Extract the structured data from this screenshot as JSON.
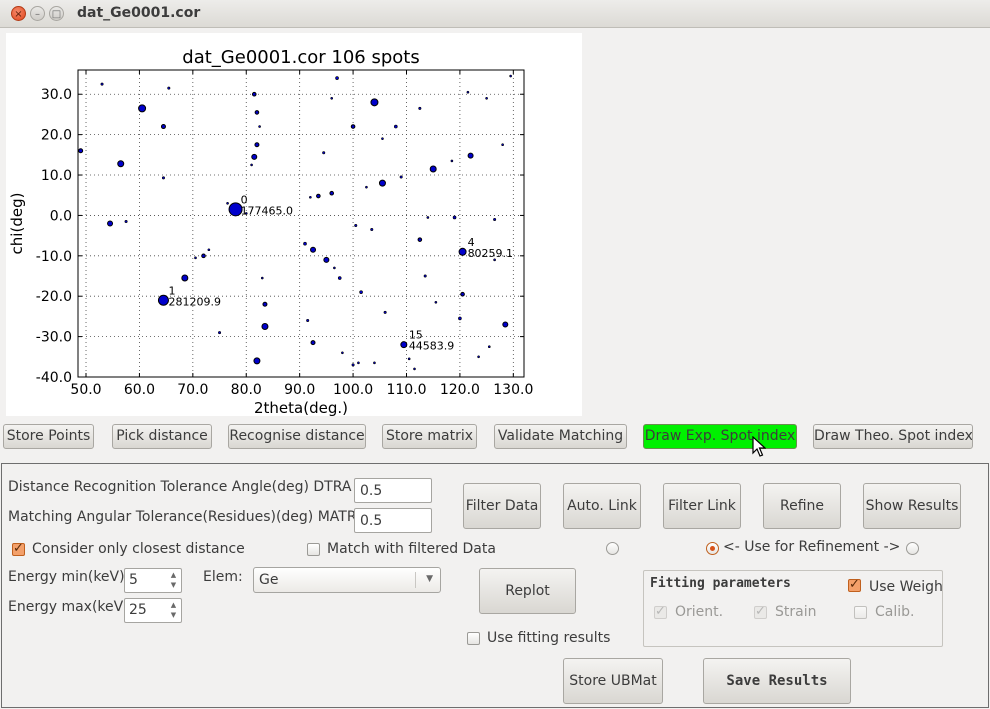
{
  "window": {
    "title": "dat_Ge0001.cor",
    "close_glyph": "×",
    "min_glyph": "–",
    "max_glyph": "□"
  },
  "chart_data": {
    "type": "scatter",
    "title": "dat_Ge0001.cor 106 spots",
    "xlabel": "2theta(deg.)",
    "ylabel": "chi(deg)",
    "xlim": [
      48.5,
      132.0
    ],
    "ylim": [
      -40.0,
      36.0
    ],
    "xticks": [
      "50.0",
      "60.0",
      "70.0",
      "80.0",
      "90.0",
      "100.0",
      "110.0",
      "120.0",
      "130.0"
    ],
    "xtick_values": [
      50,
      60,
      70,
      80,
      90,
      100,
      110,
      120,
      130
    ],
    "yticks": [
      "30.0",
      "20.0",
      "10.0",
      "0.0",
      "-10.0",
      "-20.0",
      "-30.0",
      "-40.0"
    ],
    "ytick_values": [
      30,
      20,
      10,
      0,
      -10,
      -20,
      -30,
      -40
    ],
    "grid": true,
    "marker_color": "#0000cc",
    "points": [
      {
        "x": 78.0,
        "y": 1.5,
        "r": 6.5
      },
      {
        "x": 64.5,
        "y": -21.0,
        "r": 5
      },
      {
        "x": 120.5,
        "y": -9.0,
        "r": 3.5
      },
      {
        "x": 109.5,
        "y": -32.0,
        "r": 3
      },
      {
        "x": 60.5,
        "y": 26.5,
        "r": 3.5
      },
      {
        "x": 56.5,
        "y": 12.8,
        "r": 3
      },
      {
        "x": 68.5,
        "y": -15.5,
        "r": 3
      },
      {
        "x": 82.0,
        "y": -36.0,
        "r": 3
      },
      {
        "x": 83.5,
        "y": -27.5,
        "r": 3
      },
      {
        "x": 104.0,
        "y": 28.0,
        "r": 3.5
      },
      {
        "x": 105.5,
        "y": 8.0,
        "r": 3
      },
      {
        "x": 115.0,
        "y": 11.5,
        "r": 3
      },
      {
        "x": 122.0,
        "y": 14.8,
        "r": 2.5
      },
      {
        "x": 128.5,
        "y": -27.0,
        "r": 2.5
      },
      {
        "x": 92.5,
        "y": -8.5,
        "r": 2.5
      },
      {
        "x": 95.0,
        "y": -11.0,
        "r": 2.5
      },
      {
        "x": 81.5,
        "y": 14.5,
        "r": 2.5
      },
      {
        "x": 82.0,
        "y": 17.5,
        "r": 2
      },
      {
        "x": 83.5,
        "y": -22.0,
        "r": 2
      },
      {
        "x": 92.5,
        "y": -31.5,
        "r": 2
      },
      {
        "x": 54.5,
        "y": -2.0,
        "r": 2.5
      },
      {
        "x": 49.0,
        "y": 16.0,
        "r": 2
      },
      {
        "x": 64.5,
        "y": 22.0,
        "r": 2
      },
      {
        "x": 72.0,
        "y": -10.0,
        "r": 1.8
      },
      {
        "x": 81.5,
        "y": 30.0,
        "r": 1.8
      },
      {
        "x": 82.0,
        "y": 25.5,
        "r": 1.8
      },
      {
        "x": 100.0,
        "y": 22.0,
        "r": 1.8
      },
      {
        "x": 108.0,
        "y": 22.0,
        "r": 1.5
      },
      {
        "x": 112.5,
        "y": -6.0,
        "r": 1.8
      },
      {
        "x": 119.0,
        "y": -0.5,
        "r": 1.5
      },
      {
        "x": 120.5,
        "y": -19.5,
        "r": 1.8
      },
      {
        "x": 120.0,
        "y": -25.5,
        "r": 1.5
      },
      {
        "x": 96.0,
        "y": 5.5,
        "r": 1.8
      },
      {
        "x": 93.5,
        "y": 4.8,
        "r": 1.8
      },
      {
        "x": 91.0,
        "y": -7.0,
        "r": 1.5
      },
      {
        "x": 97.5,
        "y": -15.5,
        "r": 1.5
      },
      {
        "x": 101.5,
        "y": -19.0,
        "r": 1.5
      },
      {
        "x": 106.0,
        "y": -24.0,
        "r": 1.2
      },
      {
        "x": 113.5,
        "y": -15.0,
        "r": 1.2
      },
      {
        "x": 57.5,
        "y": -1.5,
        "r": 1.2
      },
      {
        "x": 53.0,
        "y": 32.5,
        "r": 1.2
      },
      {
        "x": 65.5,
        "y": 31.5,
        "r": 1.2
      },
      {
        "x": 64.5,
        "y": 9.3,
        "r": 1.2
      },
      {
        "x": 73.0,
        "y": -8.5,
        "r": 1
      },
      {
        "x": 75.0,
        "y": -29.0,
        "r": 1.2
      },
      {
        "x": 82.5,
        "y": 22.0,
        "r": 1
      },
      {
        "x": 81.0,
        "y": 12.5,
        "r": 1
      },
      {
        "x": 83.0,
        "y": -15.5,
        "r": 1
      },
      {
        "x": 91.5,
        "y": -26.0,
        "r": 1.2
      },
      {
        "x": 92.0,
        "y": 4.5,
        "r": 1
      },
      {
        "x": 94.5,
        "y": 15.5,
        "r": 1.2
      },
      {
        "x": 96.0,
        "y": 29.0,
        "r": 1
      },
      {
        "x": 97.0,
        "y": 34.0,
        "r": 1.5
      },
      {
        "x": 96.5,
        "y": -13.0,
        "r": 1
      },
      {
        "x": 98.0,
        "y": -34.0,
        "r": 1
      },
      {
        "x": 100.0,
        "y": -37.0,
        "r": 1.2
      },
      {
        "x": 101.0,
        "y": -36.5,
        "r": 1
      },
      {
        "x": 100.5,
        "y": -2.5,
        "r": 1.2
      },
      {
        "x": 102.5,
        "y": 7.0,
        "r": 1
      },
      {
        "x": 103.5,
        "y": -3.5,
        "r": 1.2
      },
      {
        "x": 104.0,
        "y": -36.5,
        "r": 1
      },
      {
        "x": 105.5,
        "y": 19.0,
        "r": 1
      },
      {
        "x": 109.0,
        "y": 9.5,
        "r": 1.2
      },
      {
        "x": 110.5,
        "y": -35.5,
        "r": 1
      },
      {
        "x": 111.5,
        "y": -38.0,
        "r": 1
      },
      {
        "x": 112.5,
        "y": 26.5,
        "r": 1.2
      },
      {
        "x": 114.0,
        "y": -0.5,
        "r": 1
      },
      {
        "x": 115.5,
        "y": -21.5,
        "r": 1
      },
      {
        "x": 118.5,
        "y": 13.5,
        "r": 1
      },
      {
        "x": 121.5,
        "y": 30.5,
        "r": 1
      },
      {
        "x": 123.5,
        "y": -35.0,
        "r": 1
      },
      {
        "x": 125.0,
        "y": 29.0,
        "r": 1
      },
      {
        "x": 125.5,
        "y": -32.5,
        "r": 1
      },
      {
        "x": 126.5,
        "y": -1.0,
        "r": 1.2
      },
      {
        "x": 126.5,
        "y": -11.0,
        "r": 1
      },
      {
        "x": 128.0,
        "y": 17.5,
        "r": 1
      },
      {
        "x": 129.5,
        "y": 34.5,
        "r": 1
      },
      {
        "x": 70.5,
        "y": -10.5,
        "r": 1
      },
      {
        "x": 76.5,
        "y": 3.0,
        "r": 1
      },
      {
        "x": 80.0,
        "y": 0.5,
        "r": 1
      }
    ],
    "annotations": [
      {
        "x": 78.0,
        "y": 1.5,
        "index": "0",
        "intensity": "177465.0"
      },
      {
        "x": 64.5,
        "y": -21.0,
        "index": "1",
        "intensity": "281209.9"
      },
      {
        "x": 120.5,
        "y": -9.0,
        "index": "4",
        "intensity": "80259.1"
      },
      {
        "x": 109.5,
        "y": -32.0,
        "index": "15",
        "intensity": "44583.9"
      }
    ]
  },
  "toolbar": {
    "store_points": "Store Points",
    "pick_distance": "Pick distance",
    "recognise_distance": "Recognise distance",
    "store_matrix": "Store matrix",
    "validate_matching": "Validate Matching",
    "draw_exp_spot_index": "Draw Exp. Spot index",
    "draw_theo_spot_index": "Draw Theo. Spot index",
    "highlight_color": "#00f000"
  },
  "params": {
    "dtra_label": "Distance Recognition Tolerance Angle(deg) DTRA",
    "dtra_value": "0.5",
    "matr_label": "Matching Angular Tolerance(Residues)(deg) MATR",
    "matr_value": "0.5",
    "closest_distance_label": "Consider only closest distance",
    "filtered_data_label": "Match with filtered Data",
    "energy_min_label": "Energy min(keV):",
    "energy_min_value": "5",
    "energy_max_label": "Energy max(keV):",
    "energy_max_value": "25",
    "elem_label": "Elem:",
    "elem_value": "Ge",
    "use_for_refinement_label": "<- Use for Refinement ->",
    "use_fitting_results_label": "Use fitting results"
  },
  "actions": {
    "filter_data": "Filter Data",
    "auto_link": "Auto. Link",
    "filter_link": "Filter Link",
    "refine": "Refine",
    "show_results": "Show Results",
    "replot": "Replot",
    "store_ubmat": "Store UBMat",
    "save_results": "Save Results"
  },
  "fitting": {
    "title": "Fitting parameters",
    "use_weights": "Use Weights",
    "orient": "Orient.",
    "strain": "Strain",
    "calib": "Calib."
  }
}
